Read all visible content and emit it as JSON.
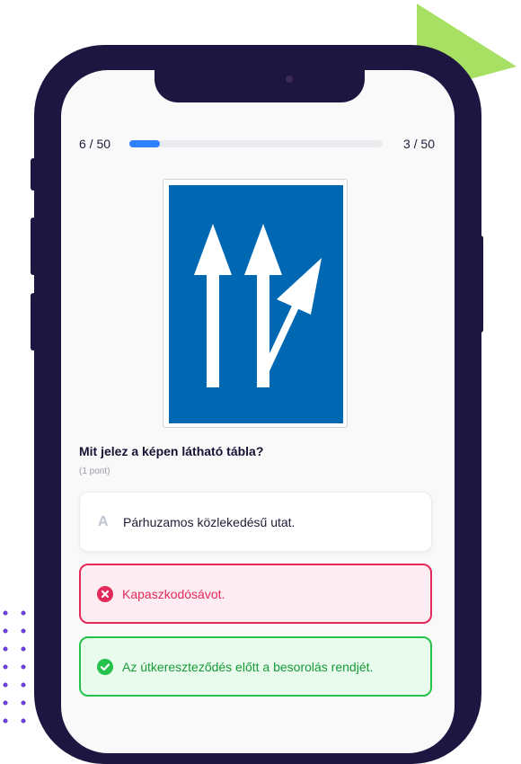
{
  "progress": {
    "current_label": "6 / 50",
    "score_label": "3 / 50",
    "fraction": 0.12
  },
  "question": {
    "text": "Mit jelez a képen látható tábla?",
    "points": "(1 pont)",
    "sign_icon": "lane-arrangement-sign-icon"
  },
  "answers": [
    {
      "letter": "A",
      "text": "Párhuzamos közlekedésű utat.",
      "state": "neutral"
    },
    {
      "letter": "",
      "text": "Kapaszkodósávot.",
      "state": "wrong",
      "icon": "x-circle-icon"
    },
    {
      "letter": "",
      "text": "Az útkereszteződés előtt a besorolás rendjét.",
      "state": "correct",
      "icon": "check-circle-icon"
    }
  ],
  "colors": {
    "accent": "#2f80ff",
    "wrong": "#e32a5a",
    "correct": "#25c24c",
    "phone_frame": "#1d1640",
    "decor_green": "#a8e063",
    "decor_purple": "#6a3fd8"
  }
}
